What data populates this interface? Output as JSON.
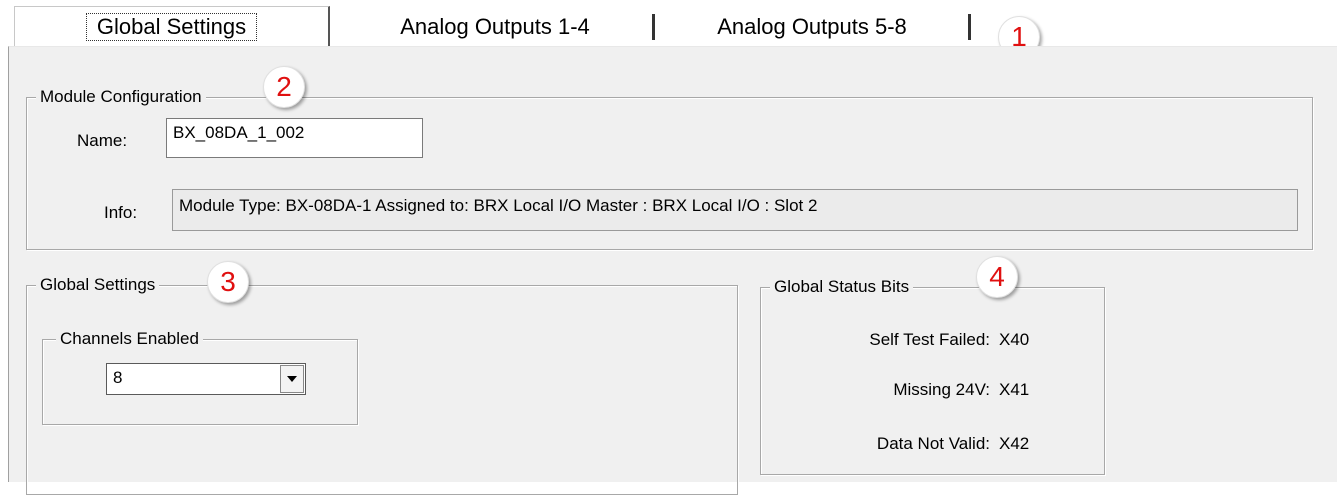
{
  "tabs": [
    {
      "label": "Global Settings",
      "selected": true
    },
    {
      "label": "Analog Outputs 1-4"
    },
    {
      "label": "Analog Outputs 5-8"
    }
  ],
  "callouts": [
    "1",
    "2",
    "3",
    "4"
  ],
  "module_config": {
    "title": "Module Configuration",
    "name_label": "Name:",
    "name_value": "BX_08DA_1_002",
    "info_label": "Info:",
    "info_value": "Module Type: BX-08DA-1   Assigned to: BRX Local I/O Master : BRX Local I/O : Slot 2"
  },
  "global_settings": {
    "title": "Global Settings",
    "channels_title": "Channels Enabled",
    "channels_value": "8"
  },
  "status_bits": {
    "title": "Global Status Bits",
    "rows": [
      {
        "label": "Self Test Failed:",
        "value": "X40"
      },
      {
        "label": "Missing 24V:",
        "value": "X41"
      },
      {
        "label": "Data Not Valid:",
        "value": "X42"
      }
    ]
  },
  "colors": {
    "callout": "#e01010",
    "panel": "#f0f0f0"
  },
  "icons": {
    "dropdown": "chevron-down-icon"
  }
}
